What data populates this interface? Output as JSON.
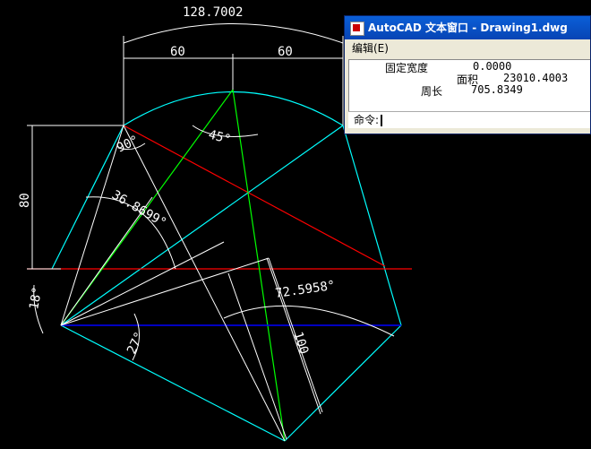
{
  "drawing": {
    "dim_arc_length": "128.7002",
    "dim_left_width": "60",
    "dim_right_width": "60",
    "dim_height": "80",
    "dim_angle_90": "90°",
    "dim_angle_45": "45°",
    "dim_angle_36": "36.8699°",
    "dim_angle_18": "18°",
    "dim_angle_27": "27°",
    "dim_angle_72": "72.5958°",
    "dim_length_100": "100",
    "colors": {
      "background": "#000000",
      "cyan": "#00ffff",
      "white": "#ffffff",
      "red": "#ff0000",
      "green": "#00ff00",
      "blue": "#0000ff"
    }
  },
  "text_window": {
    "title": "AutoCAD 文本窗口 - Drawing1.dwg",
    "menu_edit": "编辑(E)",
    "line1_label": "固定宽度",
    "line1_value": "0.0000",
    "line2_label": "面积",
    "line2_value": "23010.4003",
    "line3_label": "周长",
    "line3_value": "705.8349",
    "command_prompt": "命令:"
  }
}
